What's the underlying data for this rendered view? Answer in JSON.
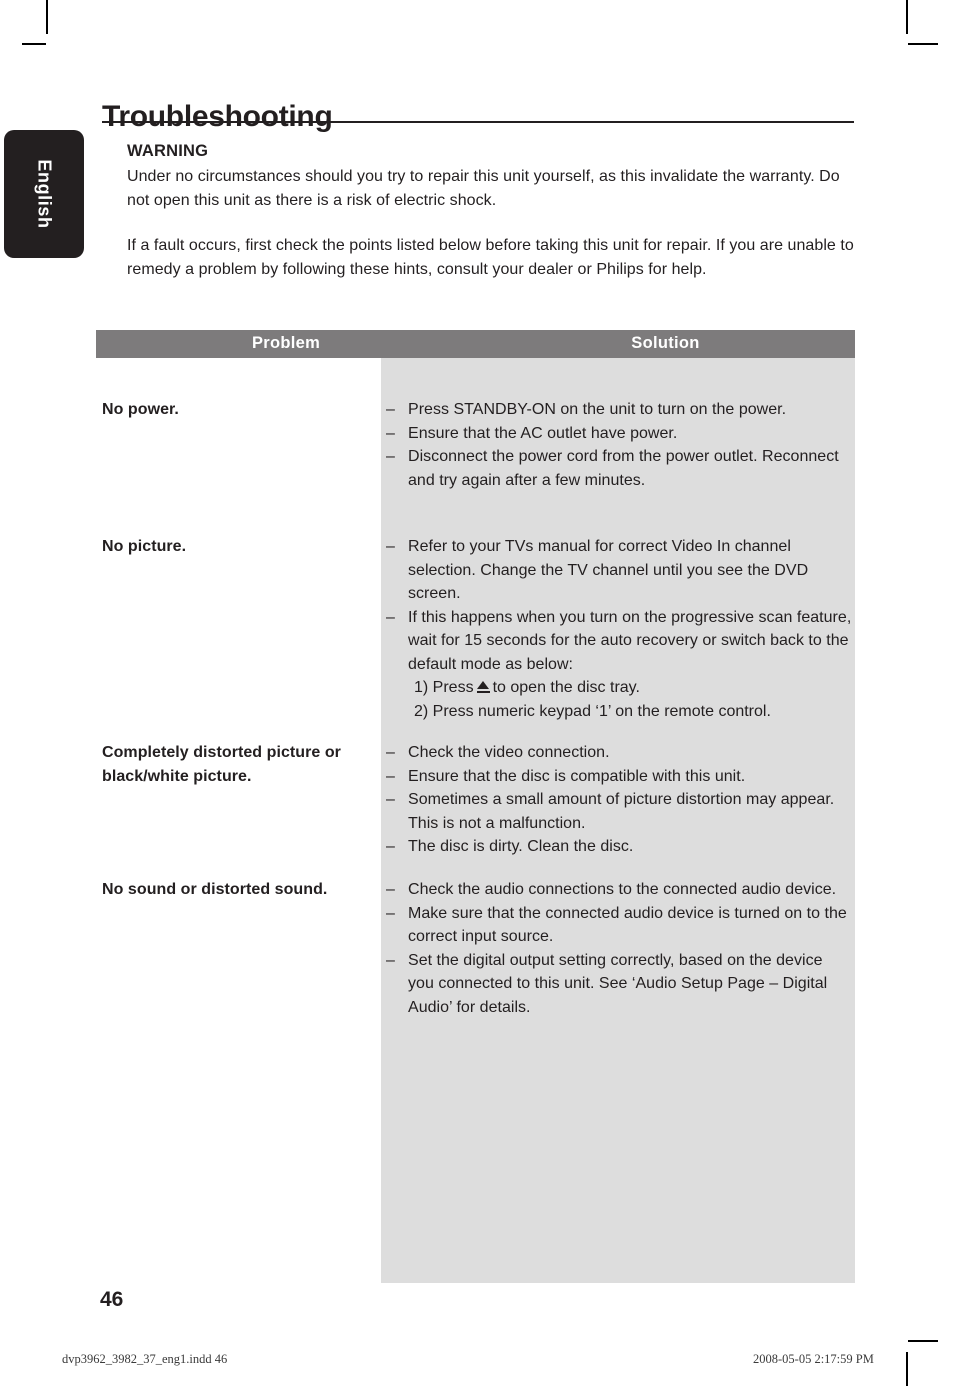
{
  "document": {
    "language_tab": "English",
    "page_title": "Troubleshooting",
    "page_number": "46"
  },
  "warning": {
    "heading": "WARNING",
    "paragraph_1": "Under no circumstances should you try to repair this unit yourself, as this invalidate the warranty. Do not open this unit as there is a risk of electric shock.",
    "paragraph_2": "If a fault occurs, first check the points listed below before taking this unit for repair. If you are unable to remedy a problem by following these hints, consult your dealer or Philips for help."
  },
  "table": {
    "header": {
      "problem": "Problem",
      "solution": "Solution"
    },
    "rows": [
      {
        "problem": "No power.",
        "solutions": [
          "Press STANDBY-ON on the unit to turn on the power.",
          "Ensure that the AC outlet have power.",
          "Disconnect the power cord from the power outlet. Reconnect and try again after a few minutes."
        ]
      },
      {
        "problem": "No picture.",
        "solutions": [
          "Refer to your TVs manual for correct Video In channel selection. Change the TV channel until you see the DVD screen.",
          "If this happens when you turn on the progressive scan feature, wait for 15 seconds for the auto recovery or switch back to the default mode as below:"
        ],
        "sub_steps": {
          "step_1_before": "1) Press",
          "step_1_icon": "eject-icon",
          "step_1_after": "to open the disc tray.",
          "step_2": "2) Press numeric keypad ‘1’ on the remote control."
        }
      },
      {
        "problem": "Completely distorted picture or black/white picture.",
        "solutions": [
          "Check the video connection.",
          "Ensure that the disc is compatible with this unit.",
          "Sometimes a small amount of picture distortion may appear. This is not a malfunction.",
          "The disc is dirty. Clean the disc."
        ]
      },
      {
        "problem": "No sound or distorted sound.",
        "solutions": [
          "Check the audio connections to the connected audio device.",
          "Make sure that the connected audio device is turned on to the correct input source.",
          "Set the digital output setting correctly, based on the device you connected to this unit. See ‘Audio Setup Page – Digital Audio’ for details."
        ]
      }
    ],
    "bullet_dash": "–"
  },
  "imprint": {
    "file": "dvp3962_3982_37_eng1.indd   46",
    "timestamp": "2008-05-05   2:17:59 PM"
  },
  "colors": {
    "header_bar": "#7d7b7c",
    "solution_band": "#dddddd",
    "text": "#231f20",
    "tab_background": "#231f20"
  }
}
